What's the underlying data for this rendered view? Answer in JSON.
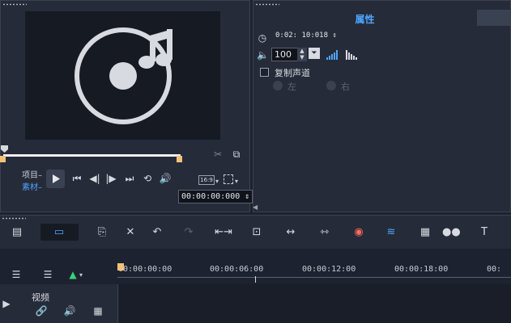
{
  "preview": {
    "project_label": "项目",
    "clip_label": "素材",
    "aspect": "16:9",
    "timecode": "00:00:00:000"
  },
  "properties": {
    "title": "属性",
    "duration": "0:02: 10:018",
    "volume": "100",
    "duplicate_channel": "复制声道",
    "left": "左",
    "right": "右"
  },
  "toolbar": {
    "items": [
      "storyboard-view",
      "timeline-view",
      "copy",
      "tools",
      "undo",
      "redo",
      "fit-project",
      "record-capture",
      "trim",
      "split",
      "chapter",
      "audio",
      "multicam",
      "mask",
      "title"
    ]
  },
  "timeline": {
    "ruler": [
      "00:00:00:00",
      "00:00:06:00",
      "00:00:12:00",
      "00:00:18:00",
      "00:"
    ],
    "track_name": "视频"
  },
  "colors": {
    "accent": "#4ea6ff",
    "handle": "#f2c27a",
    "panel": "#262b39",
    "background": "#1d2230"
  }
}
